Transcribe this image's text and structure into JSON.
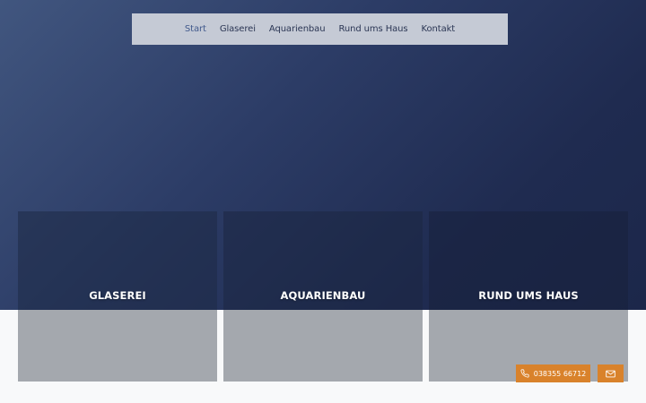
{
  "nav": {
    "items": [
      {
        "label": "Start",
        "active": true
      },
      {
        "label": "Glaserei",
        "active": false
      },
      {
        "label": "Aquarienbau",
        "active": false
      },
      {
        "label": "Rund ums Haus",
        "active": false
      },
      {
        "label": "Kontakt",
        "active": false
      }
    ]
  },
  "tiles": [
    {
      "title": "GLASEREI"
    },
    {
      "title": "AQUARIENBAU"
    },
    {
      "title": "RUND UMS HAUS"
    }
  ],
  "contact": {
    "phone": "038355 66712",
    "phone_icon": "phone-icon",
    "mail_icon": "mail-icon"
  },
  "colors": {
    "accent": "#d9822b",
    "hero_dark": "#1c274a",
    "nav_bg": "#c5cad5",
    "nav_active": "#41598c"
  }
}
